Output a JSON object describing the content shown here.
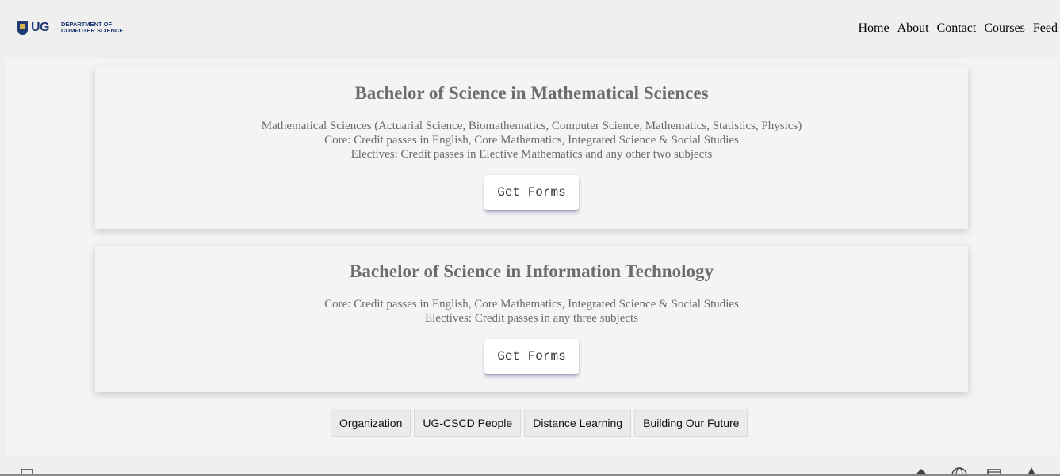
{
  "header": {
    "logo": {
      "mark": "UG",
      "dept_line1": "DEPARTMENT OF",
      "dept_line2": "COMPUTER SCIENCE"
    },
    "nav": [
      "Home",
      "About",
      "Contact",
      "Courses",
      "Feed"
    ]
  },
  "programs": [
    {
      "title": "Bachelor of Science in Mathematical Sciences",
      "lines": [
        "Mathematical Sciences (Actuarial Science, Biomathematics, Computer Science, Mathematics, Statistics, Physics)",
        "Core: Credit passes in English, Core Mathematics, Integrated Science & Social Studies",
        "Electives: Credit passes in Elective Mathematics and any other two subjects"
      ],
      "button": "Get Forms"
    },
    {
      "title": "Bachelor of Science in Information Technology",
      "lines": [
        "Core: Credit passes in English, Core Mathematics, Integrated Science & Social Studies",
        "Electives: Credit passes in any three subjects"
      ],
      "button": "Get Forms"
    }
  ],
  "tags": [
    "Organization",
    "UG-CSCD People",
    "Distance Learning",
    "Building Our Future"
  ],
  "footer_icons": [
    "mail-icon",
    "home-icon",
    "globe-icon",
    "calendar-icon",
    "user-icon"
  ],
  "colors": {
    "brand": "#1f3b73",
    "background": "#efefef",
    "card": "#f4f4f4",
    "text_muted": "#6d6d6d"
  }
}
